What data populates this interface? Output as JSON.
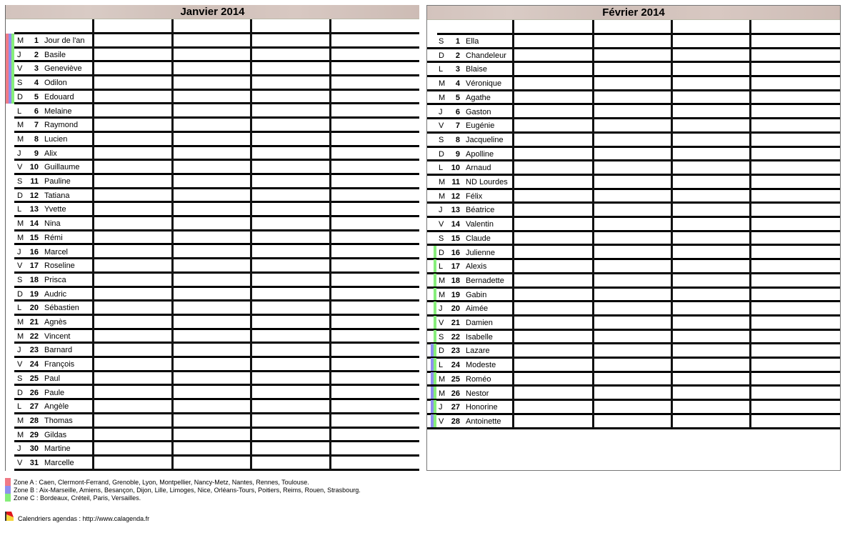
{
  "zone_colors": {
    "A": "#f07a86",
    "B": "#8f8fee",
    "C": "#86ee7a"
  },
  "months": [
    {
      "title": "Janvier 2014",
      "days": [
        {
          "dow": "M",
          "num": "1",
          "name": "Jour de l'an",
          "zones": [
            "A",
            "B",
            "C"
          ]
        },
        {
          "dow": "J",
          "num": "2",
          "name": "Basile",
          "zones": [
            "A",
            "B",
            "C"
          ]
        },
        {
          "dow": "V",
          "num": "3",
          "name": "Geneviève",
          "zones": [
            "A",
            "B",
            "C"
          ]
        },
        {
          "dow": "S",
          "num": "4",
          "name": "Odilon",
          "zones": [
            "A",
            "B",
            "C"
          ]
        },
        {
          "dow": "D",
          "num": "5",
          "name": "Edouard",
          "zones": [
            "A",
            "B",
            "C"
          ]
        },
        {
          "dow": "L",
          "num": "6",
          "name": "Melaine",
          "zones": []
        },
        {
          "dow": "M",
          "num": "7",
          "name": "Raymond",
          "zones": []
        },
        {
          "dow": "M",
          "num": "8",
          "name": "Lucien",
          "zones": []
        },
        {
          "dow": "J",
          "num": "9",
          "name": "Alix",
          "zones": []
        },
        {
          "dow": "V",
          "num": "10",
          "name": "Guillaume",
          "zones": []
        },
        {
          "dow": "S",
          "num": "11",
          "name": "Pauline",
          "zones": []
        },
        {
          "dow": "D",
          "num": "12",
          "name": "Tatiana",
          "zones": []
        },
        {
          "dow": "L",
          "num": "13",
          "name": "Yvette",
          "zones": []
        },
        {
          "dow": "M",
          "num": "14",
          "name": "Nina",
          "zones": []
        },
        {
          "dow": "M",
          "num": "15",
          "name": "Rémi",
          "zones": []
        },
        {
          "dow": "J",
          "num": "16",
          "name": "Marcel",
          "zones": []
        },
        {
          "dow": "V",
          "num": "17",
          "name": "Roseline",
          "zones": []
        },
        {
          "dow": "S",
          "num": "18",
          "name": "Prisca",
          "zones": []
        },
        {
          "dow": "D",
          "num": "19",
          "name": "Audric",
          "zones": []
        },
        {
          "dow": "L",
          "num": "20",
          "name": "Sébastien",
          "zones": []
        },
        {
          "dow": "M",
          "num": "21",
          "name": "Agnès",
          "zones": []
        },
        {
          "dow": "M",
          "num": "22",
          "name": "Vincent",
          "zones": []
        },
        {
          "dow": "J",
          "num": "23",
          "name": "Barnard",
          "zones": []
        },
        {
          "dow": "V",
          "num": "24",
          "name": "François",
          "zones": []
        },
        {
          "dow": "S",
          "num": "25",
          "name": "Paul",
          "zones": []
        },
        {
          "dow": "D",
          "num": "26",
          "name": "Paule",
          "zones": []
        },
        {
          "dow": "L",
          "num": "27",
          "name": "Angèle",
          "zones": []
        },
        {
          "dow": "M",
          "num": "28",
          "name": "Thomas",
          "zones": []
        },
        {
          "dow": "M",
          "num": "29",
          "name": "Gildas",
          "zones": []
        },
        {
          "dow": "J",
          "num": "30",
          "name": "Martine",
          "zones": []
        },
        {
          "dow": "V",
          "num": "31",
          "name": "Marcelle",
          "zones": []
        }
      ]
    },
    {
      "title": "Février 2014",
      "days": [
        {
          "dow": "S",
          "num": "1",
          "name": "Ella",
          "zones": []
        },
        {
          "dow": "D",
          "num": "2",
          "name": "Chandeleur",
          "zones": []
        },
        {
          "dow": "L",
          "num": "3",
          "name": "Blaise",
          "zones": []
        },
        {
          "dow": "M",
          "num": "4",
          "name": "Véronique",
          "zones": []
        },
        {
          "dow": "M",
          "num": "5",
          "name": "Agathe",
          "zones": []
        },
        {
          "dow": "J",
          "num": "6",
          "name": "Gaston",
          "zones": []
        },
        {
          "dow": "V",
          "num": "7",
          "name": "Eugénie",
          "zones": []
        },
        {
          "dow": "S",
          "num": "8",
          "name": "Jacqueline",
          "zones": []
        },
        {
          "dow": "D",
          "num": "9",
          "name": "Apolline",
          "zones": []
        },
        {
          "dow": "L",
          "num": "10",
          "name": "Arnaud",
          "zones": []
        },
        {
          "dow": "M",
          "num": "11",
          "name": "ND Lourdes",
          "zones": []
        },
        {
          "dow": "M",
          "num": "12",
          "name": "Félix",
          "zones": []
        },
        {
          "dow": "J",
          "num": "13",
          "name": "Béatrice",
          "zones": []
        },
        {
          "dow": "V",
          "num": "14",
          "name": "Valentin",
          "zones": []
        },
        {
          "dow": "S",
          "num": "15",
          "name": "Claude",
          "zones": []
        },
        {
          "dow": "D",
          "num": "16",
          "name": "Julienne",
          "zones": [
            "C"
          ]
        },
        {
          "dow": "L",
          "num": "17",
          "name": "Alexis",
          "zones": [
            "C"
          ]
        },
        {
          "dow": "M",
          "num": "18",
          "name": "Bernadette",
          "zones": [
            "C"
          ]
        },
        {
          "dow": "M",
          "num": "19",
          "name": "Gabin",
          "zones": [
            "C"
          ]
        },
        {
          "dow": "J",
          "num": "20",
          "name": "Aimée",
          "zones": [
            "C"
          ]
        },
        {
          "dow": "V",
          "num": "21",
          "name": "Damien",
          "zones": [
            "C"
          ]
        },
        {
          "dow": "S",
          "num": "22",
          "name": "Isabelle",
          "zones": [
            "C"
          ]
        },
        {
          "dow": "D",
          "num": "23",
          "name": "Lazare",
          "zones": [
            "B",
            "C"
          ]
        },
        {
          "dow": "L",
          "num": "24",
          "name": "Modeste",
          "zones": [
            "B",
            "C"
          ]
        },
        {
          "dow": "M",
          "num": "25",
          "name": "Roméo",
          "zones": [
            "B",
            "C"
          ]
        },
        {
          "dow": "M",
          "num": "26",
          "name": "Nestor",
          "zones": [
            "B",
            "C"
          ]
        },
        {
          "dow": "J",
          "num": "27",
          "name": "Honorine",
          "zones": [
            "B",
            "C"
          ]
        },
        {
          "dow": "V",
          "num": "28",
          "name": "Antoinette",
          "zones": [
            "B",
            "C"
          ]
        }
      ]
    }
  ],
  "legend": [
    {
      "zone": "A",
      "text": "Zone A : Caen, Clermont-Ferrand, Grenoble, Lyon, Montpellier, Nancy-Metz, Nantes, Rennes, Toulouse."
    },
    {
      "zone": "B",
      "text": "Zone B : Aix-Marseille, Amiens, Besançon, Dijon, Lille, Limoges, Nice, Orléans-Tours, Poitiers, Reims, Rouen, Strasbourg."
    },
    {
      "zone": "C",
      "text": "Zone C : Bordeaux, Créteil, Paris, Versailles."
    }
  ],
  "footer": {
    "icon": "calendar-flag-icon",
    "text": "Calendriers agendas : http://www.calagenda.fr"
  }
}
